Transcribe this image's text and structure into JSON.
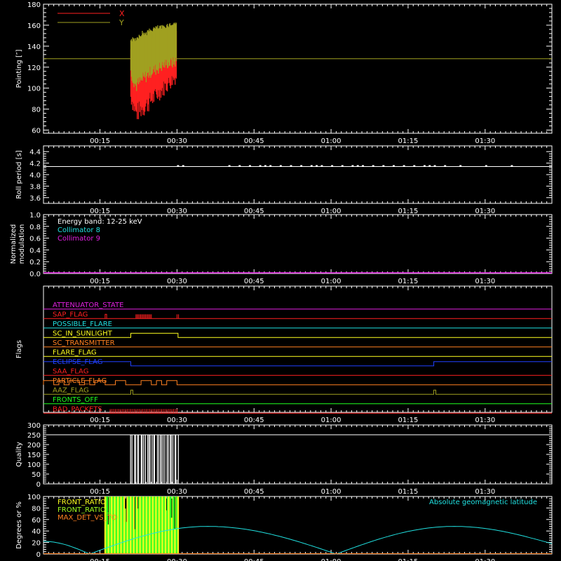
{
  "x_axis": {
    "range_minutes": [
      4,
      103
    ],
    "ticks": [
      15,
      30,
      45,
      60,
      75,
      90
    ],
    "tick_labels": [
      "00:15",
      "00:30",
      "00:45",
      "01:00",
      "01:15",
      "01:30"
    ]
  },
  "colors": {
    "white": "#ffffff",
    "red": "#ff2020",
    "olive": "#a0a020",
    "cyan": "#20e0e0",
    "magenta": "#e020e0",
    "yellow": "#ffff20",
    "orange": "#ff8020",
    "blue": "#2040ff",
    "green": "#20ff20",
    "lime": "#a0ff20"
  },
  "chart_data": [
    {
      "id": "pointing",
      "type": "line",
      "ylabel": "Pointing [″]",
      "ylim": [
        57,
        180
      ],
      "yticks": [
        60,
        80,
        100,
        120,
        140,
        160,
        180
      ],
      "reference_line": 128,
      "burst_window": [
        21,
        30.2
      ],
      "legend": [
        "X",
        "Y"
      ],
      "series": [
        {
          "name": "X",
          "color": "red",
          "x": [
            21,
            22,
            23,
            24,
            25,
            26,
            27,
            28,
            29,
            30
          ],
          "min": [
            85,
            66,
            70,
            74,
            80,
            85,
            90,
            95,
            100,
            105
          ],
          "max": [
            140,
            145,
            148,
            150,
            150,
            150,
            155,
            158,
            158,
            160
          ]
        },
        {
          "name": "Y",
          "color": "olive",
          "x": [
            21,
            22,
            23,
            24,
            25,
            26,
            27,
            28,
            29,
            30
          ],
          "min": [
            110,
            95,
            100,
            105,
            110,
            112,
            115,
            118,
            118,
            120
          ],
          "max": [
            148,
            150,
            155,
            155,
            158,
            160,
            160,
            162,
            163,
            165
          ]
        }
      ]
    },
    {
      "id": "roll",
      "type": "line",
      "ylabel": "Roll period [s]",
      "ylim": [
        3.5,
        4.5
      ],
      "yticks": [
        3.6,
        3.8,
        4.0,
        4.2,
        4.4
      ],
      "tick_labels": [
        "3.6",
        "3.8",
        "4.0",
        "4.2",
        "4.4"
      ],
      "baseline": 4.14,
      "blips": [
        30,
        31,
        40,
        42,
        44,
        46,
        47,
        48,
        50,
        52,
        54,
        56,
        57,
        58,
        60,
        62,
        64,
        65,
        66,
        68,
        70,
        72,
        74,
        76,
        78,
        79,
        80,
        82,
        85,
        90,
        95
      ]
    },
    {
      "id": "modulation",
      "type": "line",
      "ylabel": [
        "Normalized",
        "modulation"
      ],
      "ylim": [
        0,
        1
      ],
      "yticks": [
        0,
        0.2,
        0.4,
        0.6,
        0.8,
        1.0
      ],
      "tick_labels": [
        "0.0",
        "0.2",
        "0.4",
        "0.6",
        "0.8",
        "1.0"
      ],
      "annotations": [
        {
          "text": "Energy band: 12-25 keV",
          "color": "white"
        },
        {
          "text": "Collimator 8",
          "color": "cyan"
        },
        {
          "text": "Collimator 9",
          "color": "magenta"
        }
      ],
      "series": [
        {
          "color": "magenta",
          "x": [
            4,
            103
          ],
          "y": [
            0,
            0
          ]
        }
      ]
    },
    {
      "id": "flags",
      "type": "line",
      "ylabel": "Flags",
      "rows": [
        {
          "label": "ATTENUATOR_STATE",
          "color": "magenta",
          "steps": []
        },
        {
          "label": "SAP_FLAG",
          "color": "red",
          "steps": [],
          "spikes": {
            "start": 22,
            "end": 25,
            "count": 14
          },
          "spikes2": [
            30,
            30.3
          ],
          "pulse": [
            16,
            16.3
          ]
        },
        {
          "label": "POSSIBLE_FLARE",
          "color": "cyan",
          "steps": []
        },
        {
          "label": "SC_IN_SUNLIGHT",
          "color": "yellow",
          "steps": [
            [
              21,
              30.2
            ]
          ]
        },
        {
          "label": "SC_TRANSMITTER",
          "color": "orange",
          "steps": []
        },
        {
          "label": "FLARE_FLAG",
          "color": "yellow",
          "steps": []
        },
        {
          "label": "ECLIPSE_FLAG",
          "color": "blue",
          "steps": [
            [
              4,
              21
            ],
            [
              80,
              103
            ]
          ]
        },
        {
          "label": "SAA_FLAG",
          "color": "red",
          "steps": []
        },
        {
          "label": "PARTICLE_FLAG",
          "color": "orange",
          "steps": [
            [
              4,
              6
            ],
            [
              7,
              8
            ],
            [
              9,
              11
            ],
            [
              12,
              13
            ],
            [
              14,
              16
            ],
            [
              18,
              20
            ],
            [
              23,
              25
            ],
            [
              26,
              27
            ],
            [
              28,
              30
            ]
          ]
        },
        {
          "label": "AAZ_FLAG",
          "color": "olive",
          "steps": [
            [
              21,
              21.4
            ],
            [
              80,
              80.4
            ]
          ]
        },
        {
          "label": "FRONTS_OFF",
          "color": "green",
          "steps": []
        },
        {
          "label": "BAD_PACKETS",
          "color": "red",
          "steps": [],
          "spikes": {
            "start": 17,
            "end": 30,
            "count": 40
          }
        }
      ]
    },
    {
      "id": "quality",
      "type": "bar",
      "ylabel": "Quality",
      "ylim": [
        0,
        300
      ],
      "yticks": [
        0,
        50,
        100,
        150,
        200,
        250,
        300
      ],
      "baseline": 250,
      "gaps": {
        "start": 21,
        "end": 30.2,
        "count": 30
      }
    },
    {
      "id": "geomagnetic",
      "type": "line",
      "ylabel": "Degrees or %",
      "ylim": [
        0,
        100
      ],
      "yticks": [
        0,
        20,
        40,
        60,
        80,
        100
      ],
      "annotations": [
        {
          "text": "FRONT_RATIO",
          "color": "yellow"
        },
        {
          "text": "FRONT_RATIO_",
          "color": "lime"
        },
        {
          "text": "MAX_DET_VS_TO",
          "color": "orange"
        },
        {
          "text": "Absolute geomagnetic latitude",
          "color": "cyan"
        }
      ],
      "latitude": {
        "color": "cyan",
        "x": [
          4,
          13,
          36,
          61,
          84,
          103
        ],
        "y": [
          22,
          0,
          48,
          0,
          48,
          18
        ]
      },
      "ratio_bars": {
        "start": 16,
        "end": 30.2,
        "count": 70
      }
    }
  ]
}
